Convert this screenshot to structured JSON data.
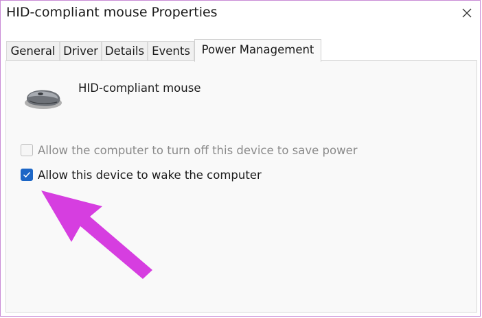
{
  "window": {
    "title": "HID-compliant mouse Properties",
    "close_icon": "close-icon"
  },
  "tabs": [
    {
      "label": "General",
      "active": false
    },
    {
      "label": "Driver",
      "active": false
    },
    {
      "label": "Details",
      "active": false
    },
    {
      "label": "Events",
      "active": false
    },
    {
      "label": "Power Management",
      "active": true
    }
  ],
  "device": {
    "name": "HID-compliant mouse",
    "icon": "mouse-icon"
  },
  "options": [
    {
      "label": "Allow the computer to turn off this device to save power",
      "checked": false,
      "enabled": false
    },
    {
      "label": "Allow this device to wake the computer",
      "checked": true,
      "enabled": true
    }
  ],
  "colors": {
    "accent": "#1c66c6",
    "annotation": "#d63ee0",
    "panel_bg": "#f9f9f9"
  }
}
